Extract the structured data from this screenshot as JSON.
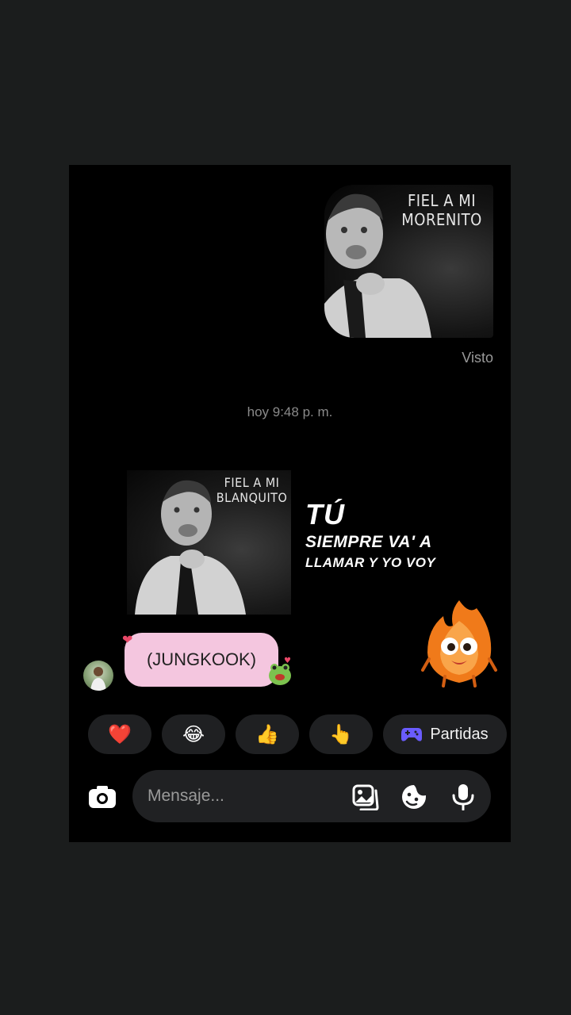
{
  "conversation": {
    "sent_image_caption": "FIEL A MI\nMORENITO",
    "seen_label": "Visto",
    "timestamp": "hoy 9:48 p. m.",
    "received_image_caption": "FIEL A MI\nBLANQUITO",
    "received_message": "(JUNGKOOK)"
  },
  "overlay_text": {
    "line1": "TÚ",
    "line2": "SIEMPRE VA' A",
    "line3": "LLAMAR Y YO VOY"
  },
  "quick_reactions": [
    {
      "icon": "heart-icon",
      "glyph": "❤️"
    },
    {
      "icon": "laughing-crying-face-icon",
      "glyph": "😂"
    },
    {
      "icon": "thumbs-up-icon",
      "glyph": "👍"
    },
    {
      "icon": "pointing-finger-icon",
      "glyph": "👆"
    }
  ],
  "games_chip": {
    "icon": "gamepad-icon",
    "label": "Partidas"
  },
  "composer": {
    "placeholder": "Mensaje..."
  },
  "colors": {
    "background": "#1b1d1d",
    "screen": "#000000",
    "bubble": "#f4c6df",
    "chip": "#1f2022",
    "composer": "#202123",
    "gamepad": "#6a5cff"
  }
}
